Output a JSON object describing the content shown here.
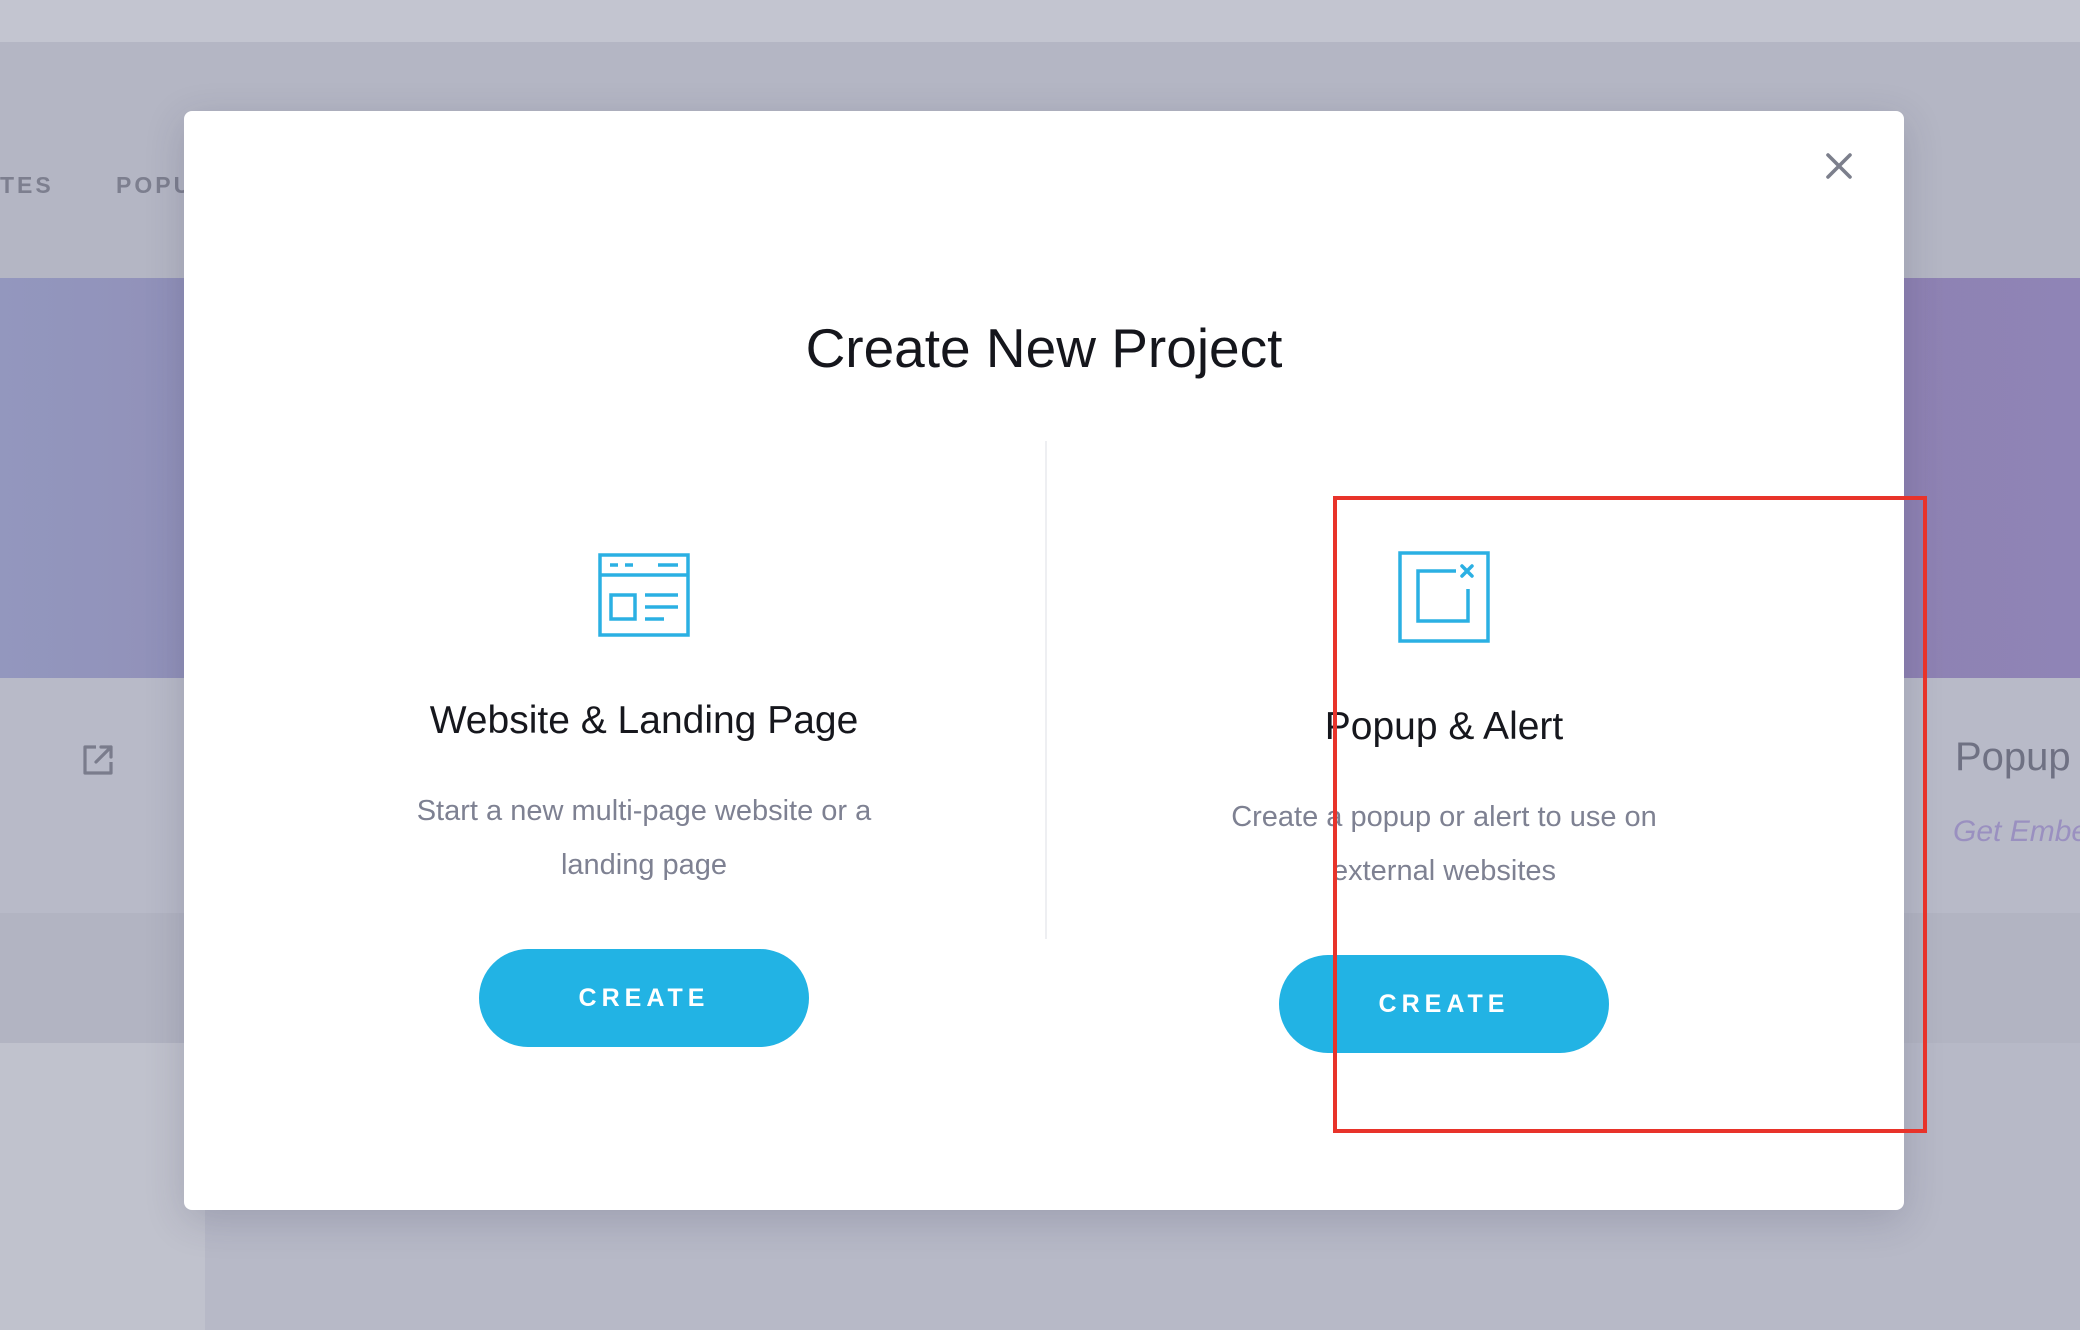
{
  "background": {
    "nav_items": [
      "TES",
      "POPU"
    ],
    "popup_label": "Popup",
    "embed_link": "Get Embe",
    "external_icon": "external-link-icon"
  },
  "modal": {
    "title": "Create New Project",
    "close_icon": "close-icon",
    "options": [
      {
        "icon": "website-layout-icon",
        "title": "Website & Landing Page",
        "description": "Start a new multi-page website or a landing page",
        "button_label": "CREATE"
      },
      {
        "icon": "popup-window-icon",
        "title": "Popup & Alert",
        "description": "Create a popup or alert to use on external websites",
        "button_label": "CREATE"
      }
    ]
  },
  "colors": {
    "accent": "#22b3e4",
    "highlight": "#e8332a",
    "title_text": "#15161c",
    "muted_text": "#7e8192"
  }
}
